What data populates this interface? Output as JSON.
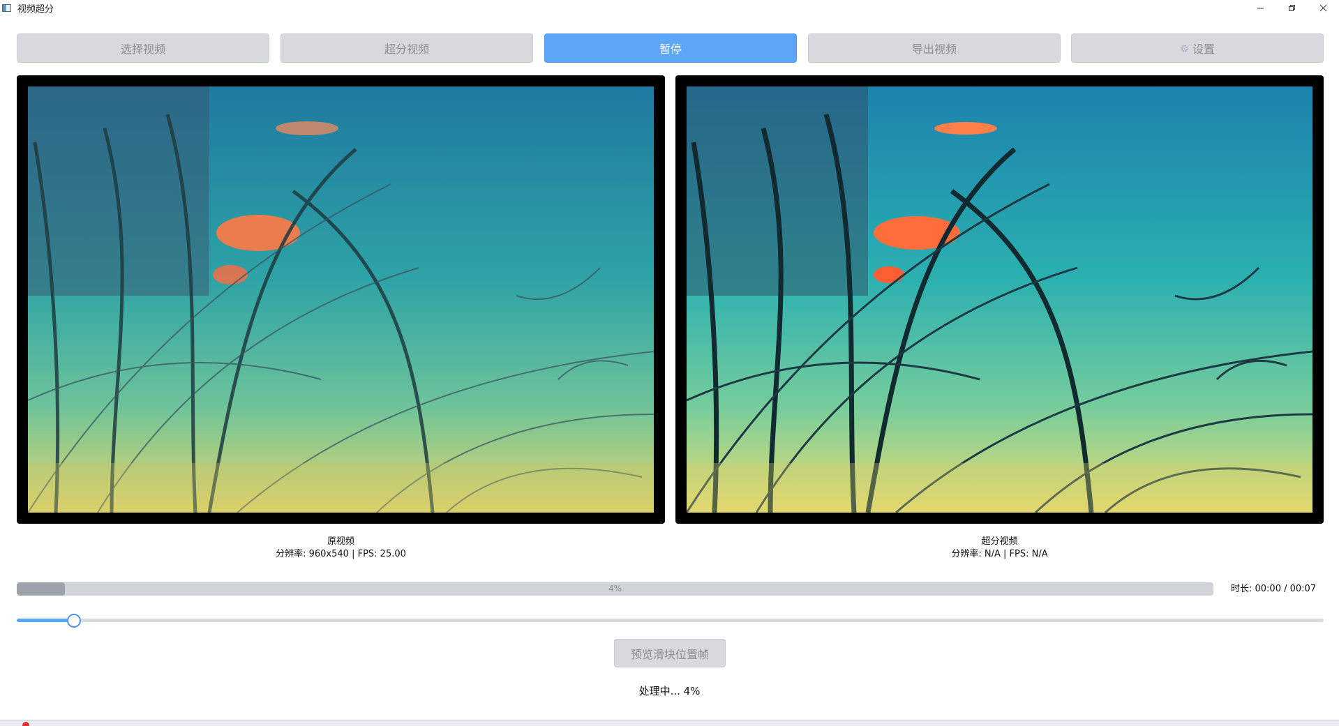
{
  "window": {
    "title": "视频超分",
    "controls": [
      "minimize-icon",
      "restore-icon",
      "close-icon"
    ]
  },
  "toolbar": {
    "select_video": "选择视频",
    "upscale_video": "超分视频",
    "pause": "暂停",
    "export_video": "导出视频",
    "settings": "设置",
    "settings_icon": "gear-icon"
  },
  "original": {
    "title": "原视频",
    "info": "分辨率: 960x540 | FPS: 25.00"
  },
  "upscaled": {
    "title": "超分视频",
    "info": "分辨率: N/A | FPS: N/A"
  },
  "progress": {
    "value": 0.04,
    "text": "4%"
  },
  "duration": "时长: 00:00 / 00:07",
  "seek": {
    "value": 0.043
  },
  "preview_button": "预览滑块位置帧",
  "status": "处理中... 4%",
  "colors": {
    "accent": "#5ca5f7",
    "button_bg": "#d7d9dd",
    "button_text": "#8a8d92",
    "progress_fill": "#9ea3ab"
  }
}
